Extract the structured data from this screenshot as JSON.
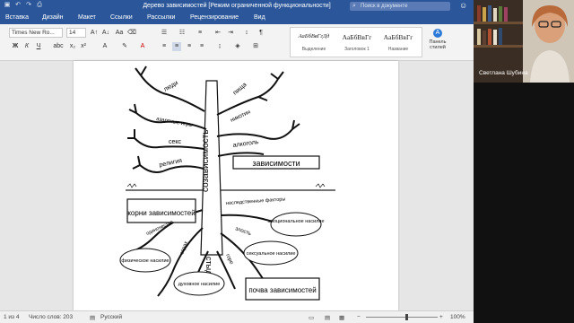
{
  "window": {
    "title": "Дерево зависимостей [Режим ограниченной функциональности]",
    "search_placeholder": "Поиск в документе"
  },
  "tabs": [
    "Вставка",
    "Дизайн",
    "Макет",
    "Ссылки",
    "Рассылки",
    "Рецензирование",
    "Вид"
  ],
  "ribbon": {
    "font_name": "Times New Ro...",
    "font_size": "14",
    "styles": [
      {
        "sample": "АаБбВвГгДд",
        "name": "Выделение"
      },
      {
        "sample": "АаБбВвГг",
        "name": "Заголовок 1"
      },
      {
        "sample": "АаБбВвГг",
        "name": "Название"
      }
    ],
    "panel_label": "Панель стилей"
  },
  "figure": {
    "trunk_label": "созависимость",
    "shame_label": "стыд",
    "branch_labels": [
      "люди",
      "пища",
      "азартные игры",
      "никотин",
      "секс",
      "алкоголь",
      "религия"
    ],
    "box_top": "зависимости",
    "box_roots": "корни зависимостей",
    "box_soil": "почва зависимостей",
    "root_labels": [
      "наследственные факторы",
      "одиночество",
      "злость",
      "страх",
      "горе"
    ],
    "oval_labels": [
      "эмоциональное насилие",
      "сексуальное насилие",
      "физическое насилие",
      "духовное насилие"
    ]
  },
  "statusbar": {
    "page": "1 из 4",
    "words": "Число слов: 203",
    "language": "Русский",
    "zoom": "100%"
  },
  "webcam": {
    "person_name": "Светлана Шубина"
  }
}
